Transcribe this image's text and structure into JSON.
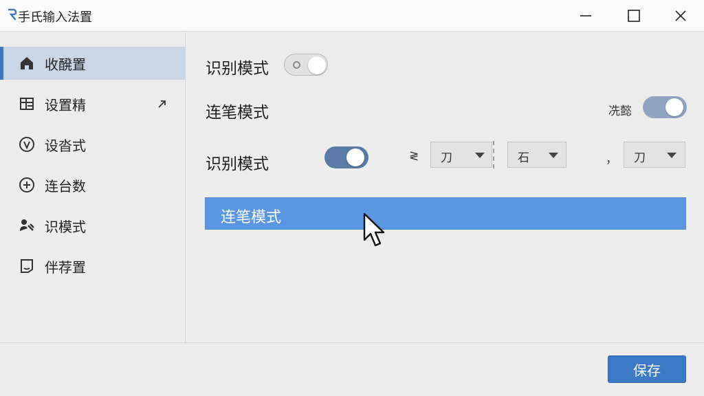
{
  "window": {
    "title": "手氏输入法置",
    "controls": [
      "minimize-icon",
      "maximize-icon",
      "close-icon"
    ]
  },
  "sidebar": {
    "items": [
      {
        "label": "收醗置",
        "icon": "home-icon",
        "active": true
      },
      {
        "label": "设置精",
        "icon": "layout-grid-icon",
        "active": false,
        "has_arrow": true
      },
      {
        "label": "设沓式",
        "icon": "shield-icon",
        "active": false
      },
      {
        "label": "连台数",
        "icon": "plus-circle-icon",
        "active": false
      },
      {
        "label": "识模式",
        "icon": "user-tools-icon",
        "active": false
      },
      {
        "label": "伴荐置",
        "icon": "tray-icon",
        "active": false
      }
    ]
  },
  "main": {
    "row1": {
      "label": "识别模式",
      "toggle_state": "off"
    },
    "row2": {
      "label": "连笔模式",
      "side_text": "冼懿",
      "toggle_state": "on"
    },
    "row3": {
      "label": "识别模式",
      "toggle_state": "on",
      "prefix_text": "≷",
      "dropdowns": [
        {
          "value": "刀"
        },
        {
          "value": "石"
        },
        {
          "value": "刀"
        }
      ],
      "sep_text": "，"
    },
    "highlight": {
      "label": "连笔模式"
    }
  },
  "footer": {
    "save_label": "保存"
  },
  "colors": {
    "accent": "#3b79c4",
    "highlight": "#5b97e0",
    "sidebar_active": "#c8d6e6",
    "toggle_on": "#5a7ba6"
  }
}
